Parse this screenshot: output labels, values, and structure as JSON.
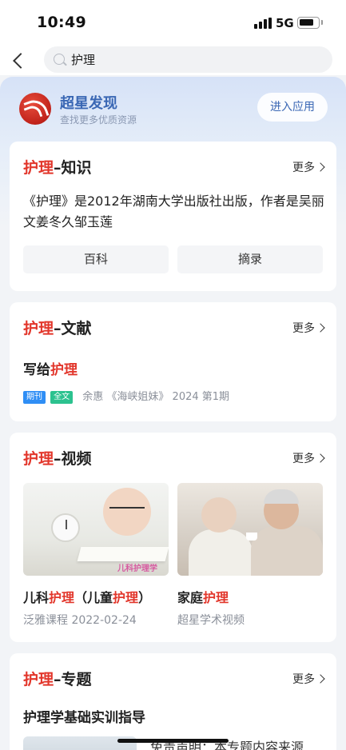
{
  "status": {
    "time": "10:49",
    "network": "5G"
  },
  "search": {
    "query": "护理"
  },
  "app": {
    "name": "超星发现",
    "subtitle": "查找更多优质资源",
    "enter_label": "进入应用"
  },
  "more_label": "更多",
  "keyword": "护理",
  "sections": {
    "knowledge": {
      "suffix": "–知识",
      "description": "《护理》是2012年湖南大学出版社出版，作者是吴丽文姜冬久邹玉莲",
      "buttons": [
        "百科",
        "摘录"
      ]
    },
    "literature": {
      "suffix": "–文献",
      "article_prefix": "写给",
      "article_keyword": "护理",
      "tag_journal": "期刊",
      "tag_fulltext": "全文",
      "meta": "余惠 《海峡姐妹》 2024 第1期"
    },
    "video": {
      "suffix": "–视频",
      "items": [
        {
          "title_a": "儿科",
          "title_kw": "护理",
          "title_b": "（儿童",
          "title_kw2": "护理",
          "title_c": "）",
          "sub": "泛雅课程  2022-02-24",
          "watermark": "儿科护理学"
        },
        {
          "title_a": "家庭",
          "title_kw": "护理",
          "sub": "超星学术视频"
        }
      ]
    },
    "topic": {
      "suffix": "–专题",
      "title": "护理学基础实训指导",
      "description": "免责声明：本专题内容来源"
    }
  }
}
